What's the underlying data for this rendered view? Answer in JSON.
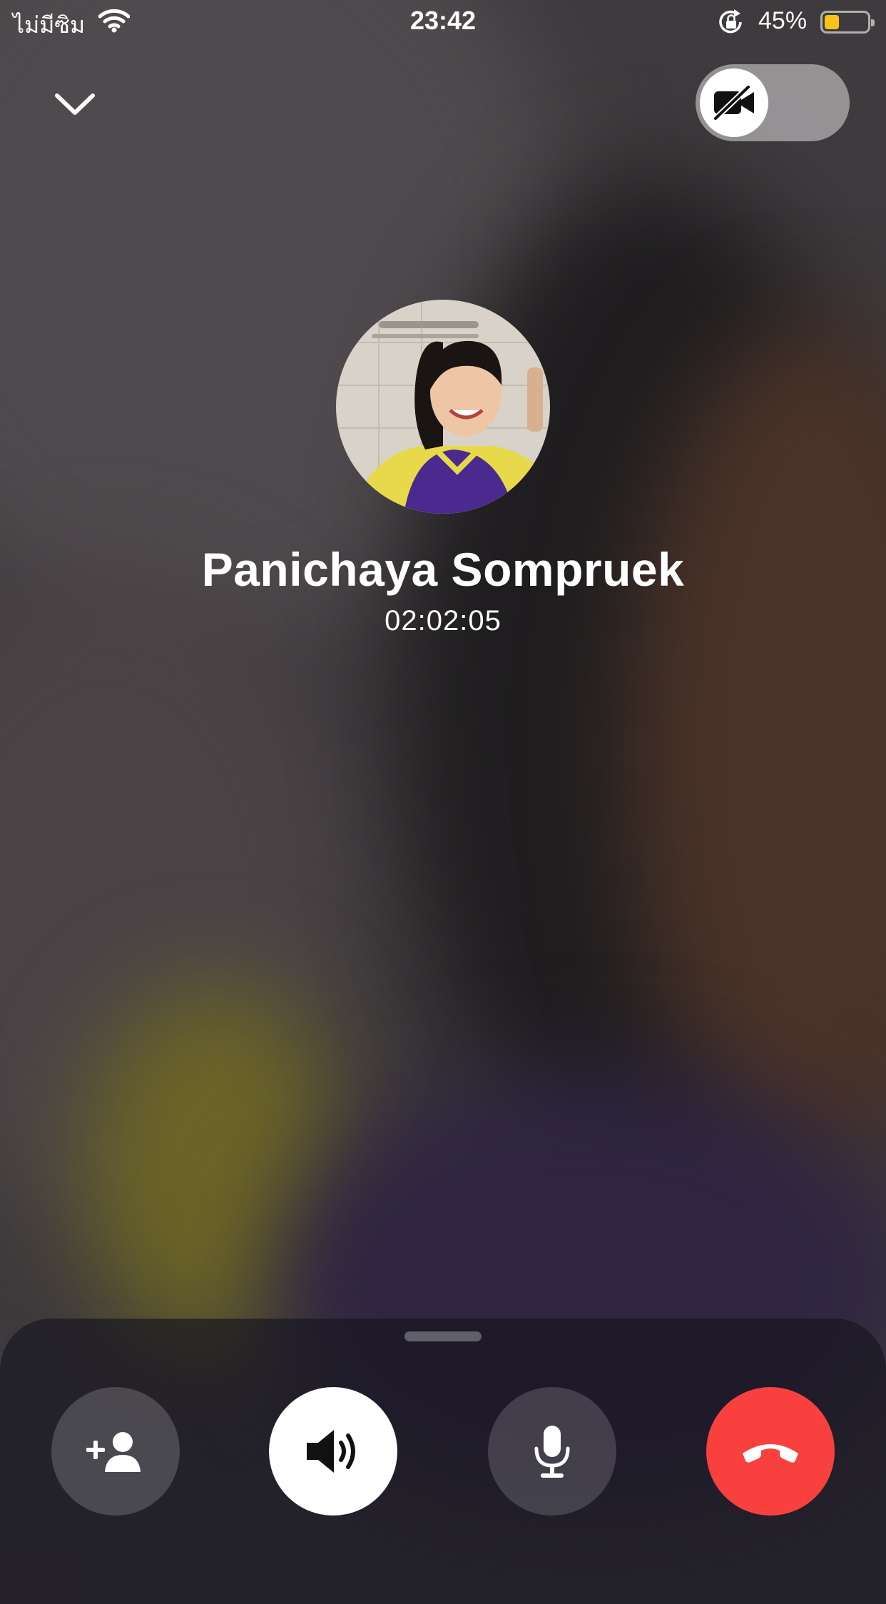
{
  "status_bar": {
    "carrier": "ไม่มีซิม",
    "time": "23:42",
    "battery_percent": "45%",
    "battery_level": 0.4,
    "battery_color": "#f6c417"
  },
  "top_controls": {
    "collapse_icon": "chevron-down-icon",
    "camera_toggle": {
      "state": "off",
      "icon": "video-off-icon"
    }
  },
  "contact": {
    "name": "Panichaya Sompruek",
    "duration": "02:02:05"
  },
  "call_controls": [
    {
      "action": "add-participant",
      "icon": "add-person-icon",
      "active": false
    },
    {
      "action": "speaker",
      "icon": "speaker-icon",
      "active": true
    },
    {
      "action": "mute",
      "icon": "microphone-icon",
      "active": false
    },
    {
      "action": "end-call",
      "icon": "end-call-icon",
      "color": "#f8413e"
    }
  ]
}
